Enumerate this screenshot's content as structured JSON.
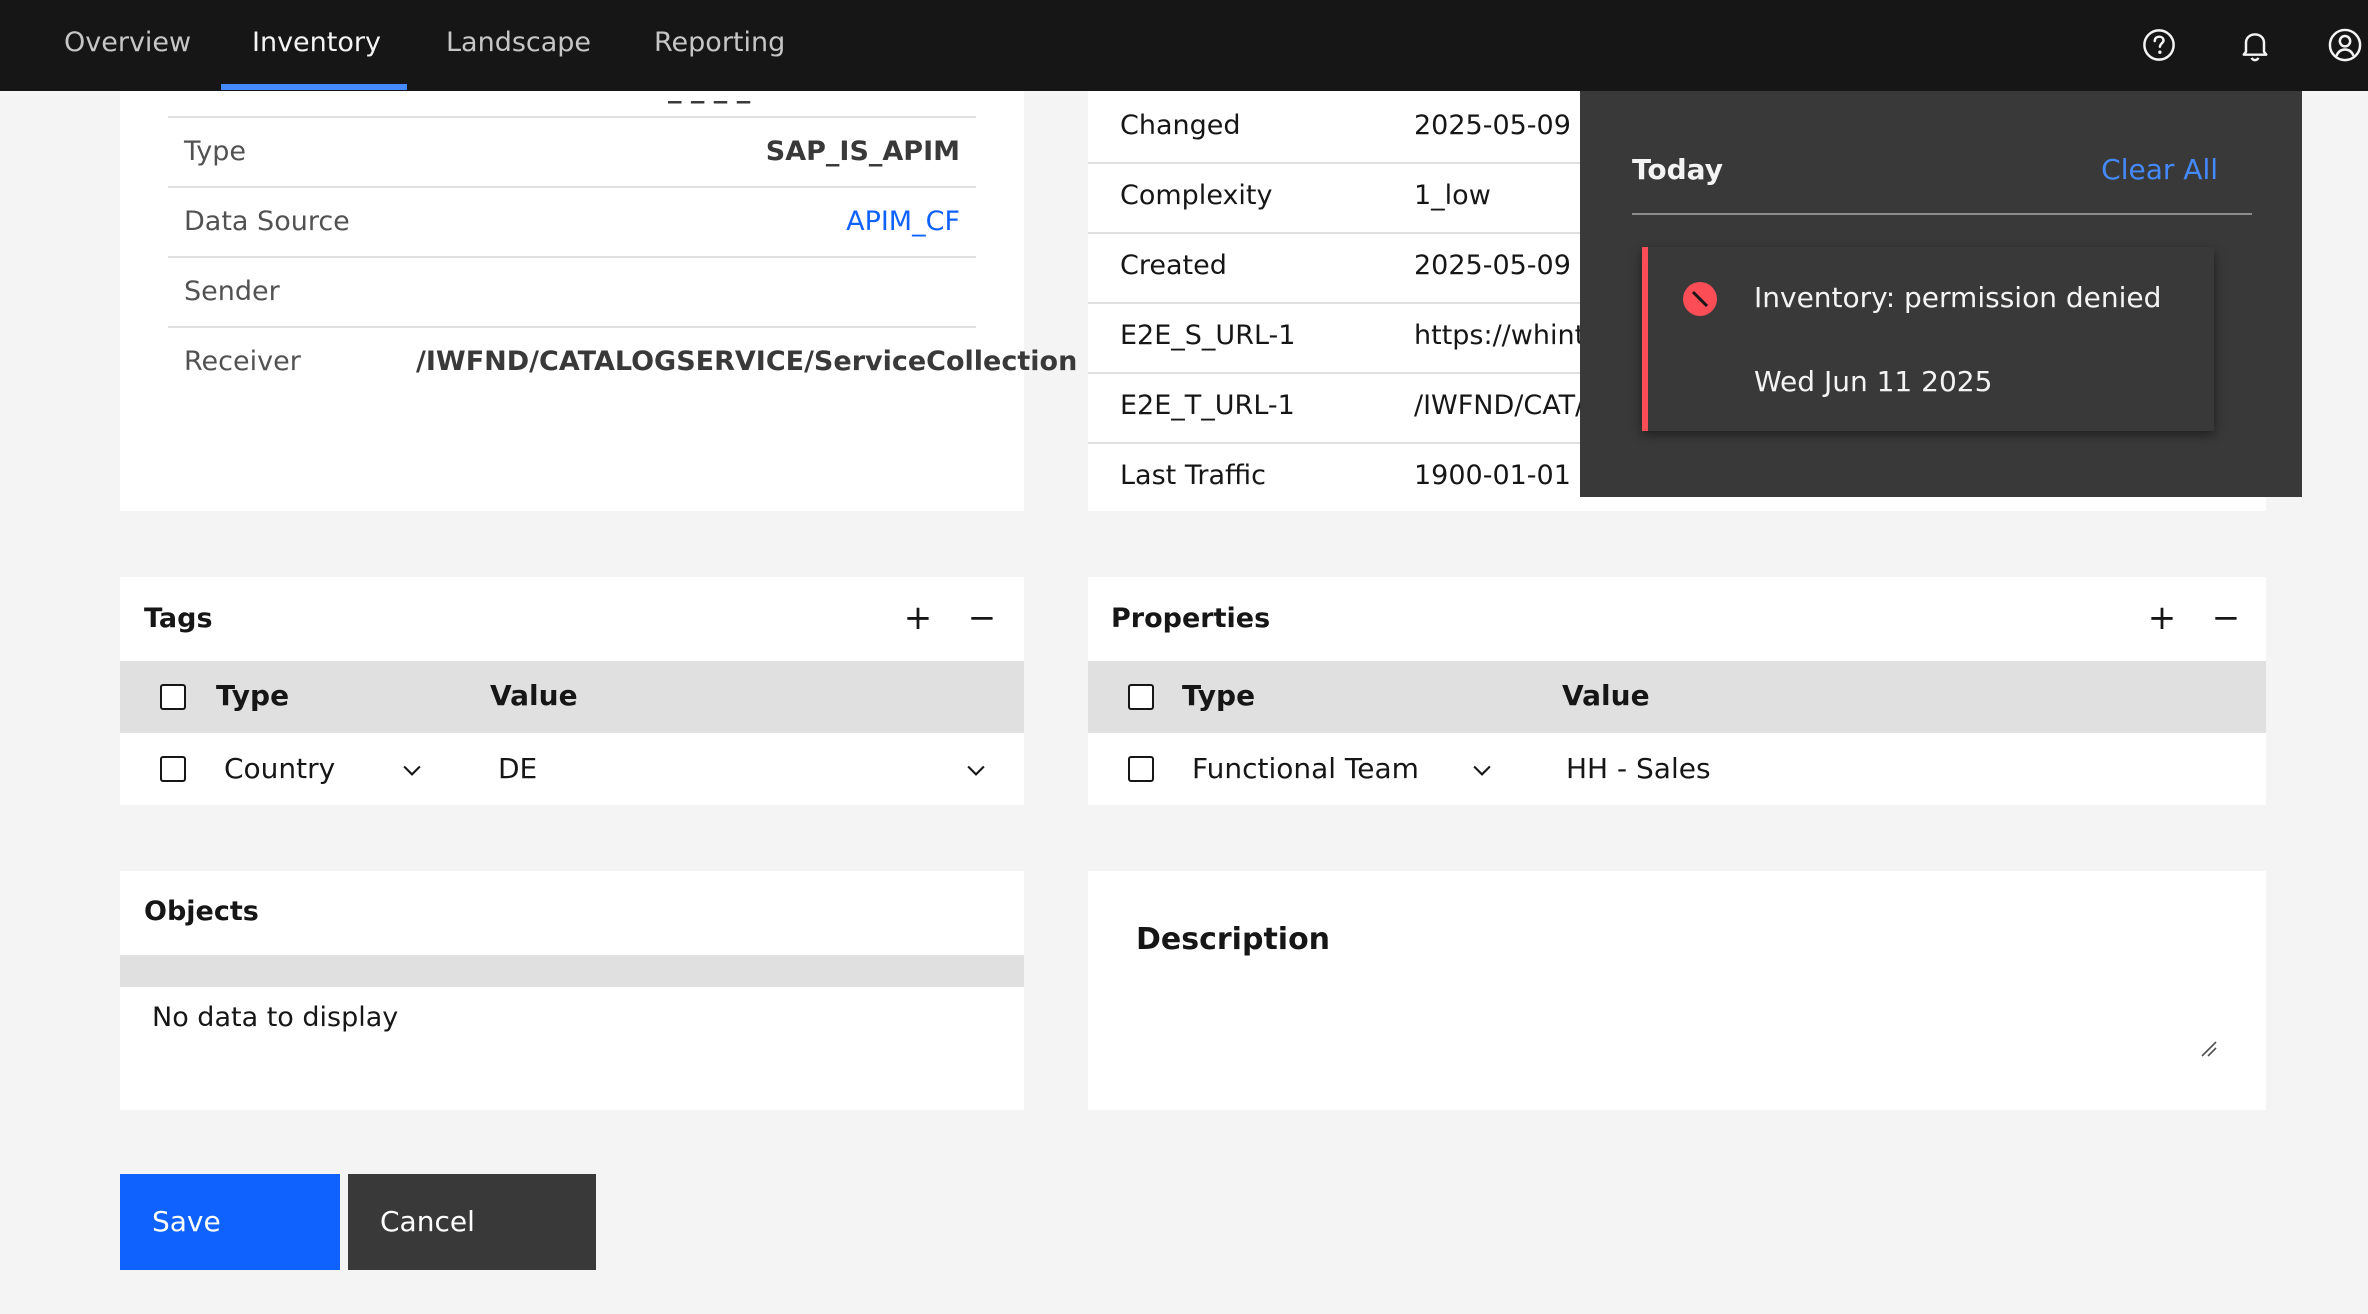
{
  "nav": {
    "items": [
      {
        "label": "Overview",
        "active": false
      },
      {
        "label": "Inventory",
        "active": true
      },
      {
        "label": "Landscape",
        "active": false
      },
      {
        "label": "Reporting",
        "active": false
      }
    ],
    "icons": [
      "help-icon",
      "notification-bell-icon",
      "user-avatar-icon"
    ]
  },
  "details_left": {
    "rows": [
      {
        "key": "Type",
        "value": "SAP_IS_APIM"
      },
      {
        "key": "Data Source",
        "value": "APIM_CF"
      },
      {
        "key": "Sender",
        "value": ""
      },
      {
        "key": "Receiver",
        "value": "/IWFND/CATALOGSERVICE/ServiceCollection"
      }
    ]
  },
  "details_right": {
    "rows": [
      {
        "key": "Changed",
        "value": "2025-05-09"
      },
      {
        "key": "Complexity",
        "value": "1_low"
      },
      {
        "key": "Created",
        "value": "2025-05-09"
      },
      {
        "key": "E2E_S_URL-1",
        "value": "https://whint"
      },
      {
        "key": "E2E_T_URL-1",
        "value": "/IWFND/CAT/"
      },
      {
        "key": "Last Traffic",
        "value": "1900-01-01"
      }
    ]
  },
  "tags": {
    "title": "Tags",
    "add": "+",
    "remove": "−",
    "col_type": "Type",
    "col_value": "Value",
    "rows": [
      {
        "type": "Country",
        "value": "DE"
      }
    ]
  },
  "properties": {
    "title": "Properties",
    "add": "+",
    "remove": "−",
    "col_type": "Type",
    "col_value": "Value",
    "rows": [
      {
        "type": "Functional Team",
        "value": "HH - Sales"
      }
    ]
  },
  "objects": {
    "title": "Objects",
    "empty": "No data to display"
  },
  "description": {
    "title": "Description"
  },
  "actions": {
    "save": "Save",
    "cancel": "Cancel"
  },
  "notifications": {
    "heading": "Today",
    "clear_all": "Clear All",
    "items": [
      {
        "title": "Inventory: permission denied",
        "date": "Wed Jun 11 2025",
        "status": "error"
      }
    ]
  },
  "colors": {
    "nav_bg": "#161616",
    "accent": "#0f62fe",
    "link": "#4589ff",
    "error": "#fa4d56",
    "panel_bg": "#393939"
  }
}
